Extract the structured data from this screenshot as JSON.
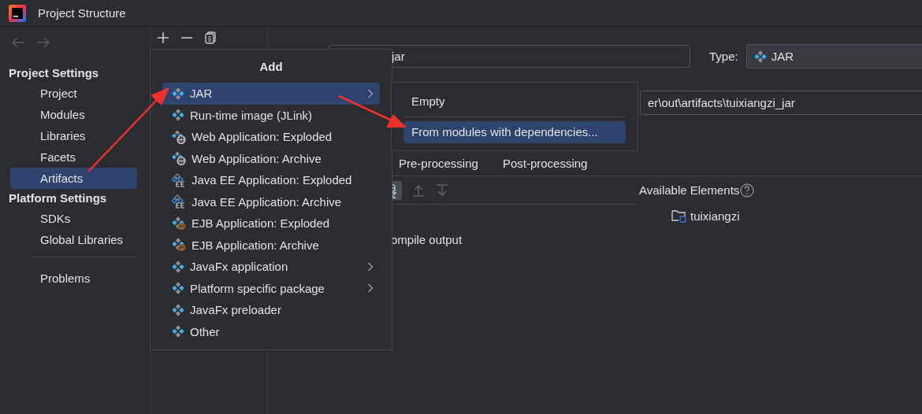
{
  "window": {
    "title": "Project Structure"
  },
  "sidebar": {
    "sections": [
      {
        "heading": "Project Settings",
        "items": [
          {
            "label": "Project",
            "selected": false
          },
          {
            "label": "Modules",
            "selected": false
          },
          {
            "label": "Libraries",
            "selected": false
          },
          {
            "label": "Facets",
            "selected": false
          },
          {
            "label": "Artifacts",
            "selected": true
          }
        ]
      },
      {
        "heading": "Platform Settings",
        "items": [
          {
            "label": "SDKs",
            "selected": false
          },
          {
            "label": "Global Libraries",
            "selected": false
          }
        ]
      },
      {
        "items": [
          {
            "label": "Problems",
            "selected": false
          }
        ]
      }
    ]
  },
  "artifact": {
    "name": "jar",
    "type_label": "Type:",
    "type": "JAR",
    "output_path": "er\\out\\artifacts\\tuixiangzi_jar",
    "tabs": [
      {
        "label": "Pre-processing",
        "selected": false
      },
      {
        "label": "Post-processing",
        "selected": false
      }
    ],
    "layout_items": [
      "ompile output"
    ],
    "available_elements": {
      "title": "Available Elements",
      "items": [
        "tuixiangzi"
      ]
    }
  },
  "add_menu": {
    "title": "Add",
    "items": [
      {
        "label": "JAR",
        "kind": "jar",
        "selected": true,
        "has_submenu": true
      },
      {
        "label": "Run-time image (JLink)",
        "kind": "jar",
        "selected": false,
        "has_submenu": false
      },
      {
        "label": "Web Application: Exploded",
        "kind": "web",
        "selected": false,
        "has_submenu": false
      },
      {
        "label": "Web Application: Archive",
        "kind": "web",
        "selected": false,
        "has_submenu": false
      },
      {
        "label": "Java EE Application: Exploded",
        "kind": "javaee",
        "selected": false,
        "has_submenu": false
      },
      {
        "label": "Java EE Application: Archive",
        "kind": "javaee",
        "selected": false,
        "has_submenu": false
      },
      {
        "label": "EJB Application: Exploded",
        "kind": "ejb",
        "selected": false,
        "has_submenu": false
      },
      {
        "label": "EJB Application: Archive",
        "kind": "ejb",
        "selected": false,
        "has_submenu": false
      },
      {
        "label": "JavaFx application",
        "kind": "jar",
        "selected": false,
        "has_submenu": true
      },
      {
        "label": "Platform specific package",
        "kind": "jar",
        "selected": false,
        "has_submenu": true
      },
      {
        "label": "JavaFx preloader",
        "kind": "jar",
        "selected": false,
        "has_submenu": false
      },
      {
        "label": "Other",
        "kind": "jar",
        "selected": false,
        "has_submenu": false
      }
    ]
  },
  "submenu": {
    "items": [
      {
        "label": "Empty",
        "selected": false
      },
      {
        "label": "From modules with dependencies...",
        "selected": true
      }
    ]
  }
}
